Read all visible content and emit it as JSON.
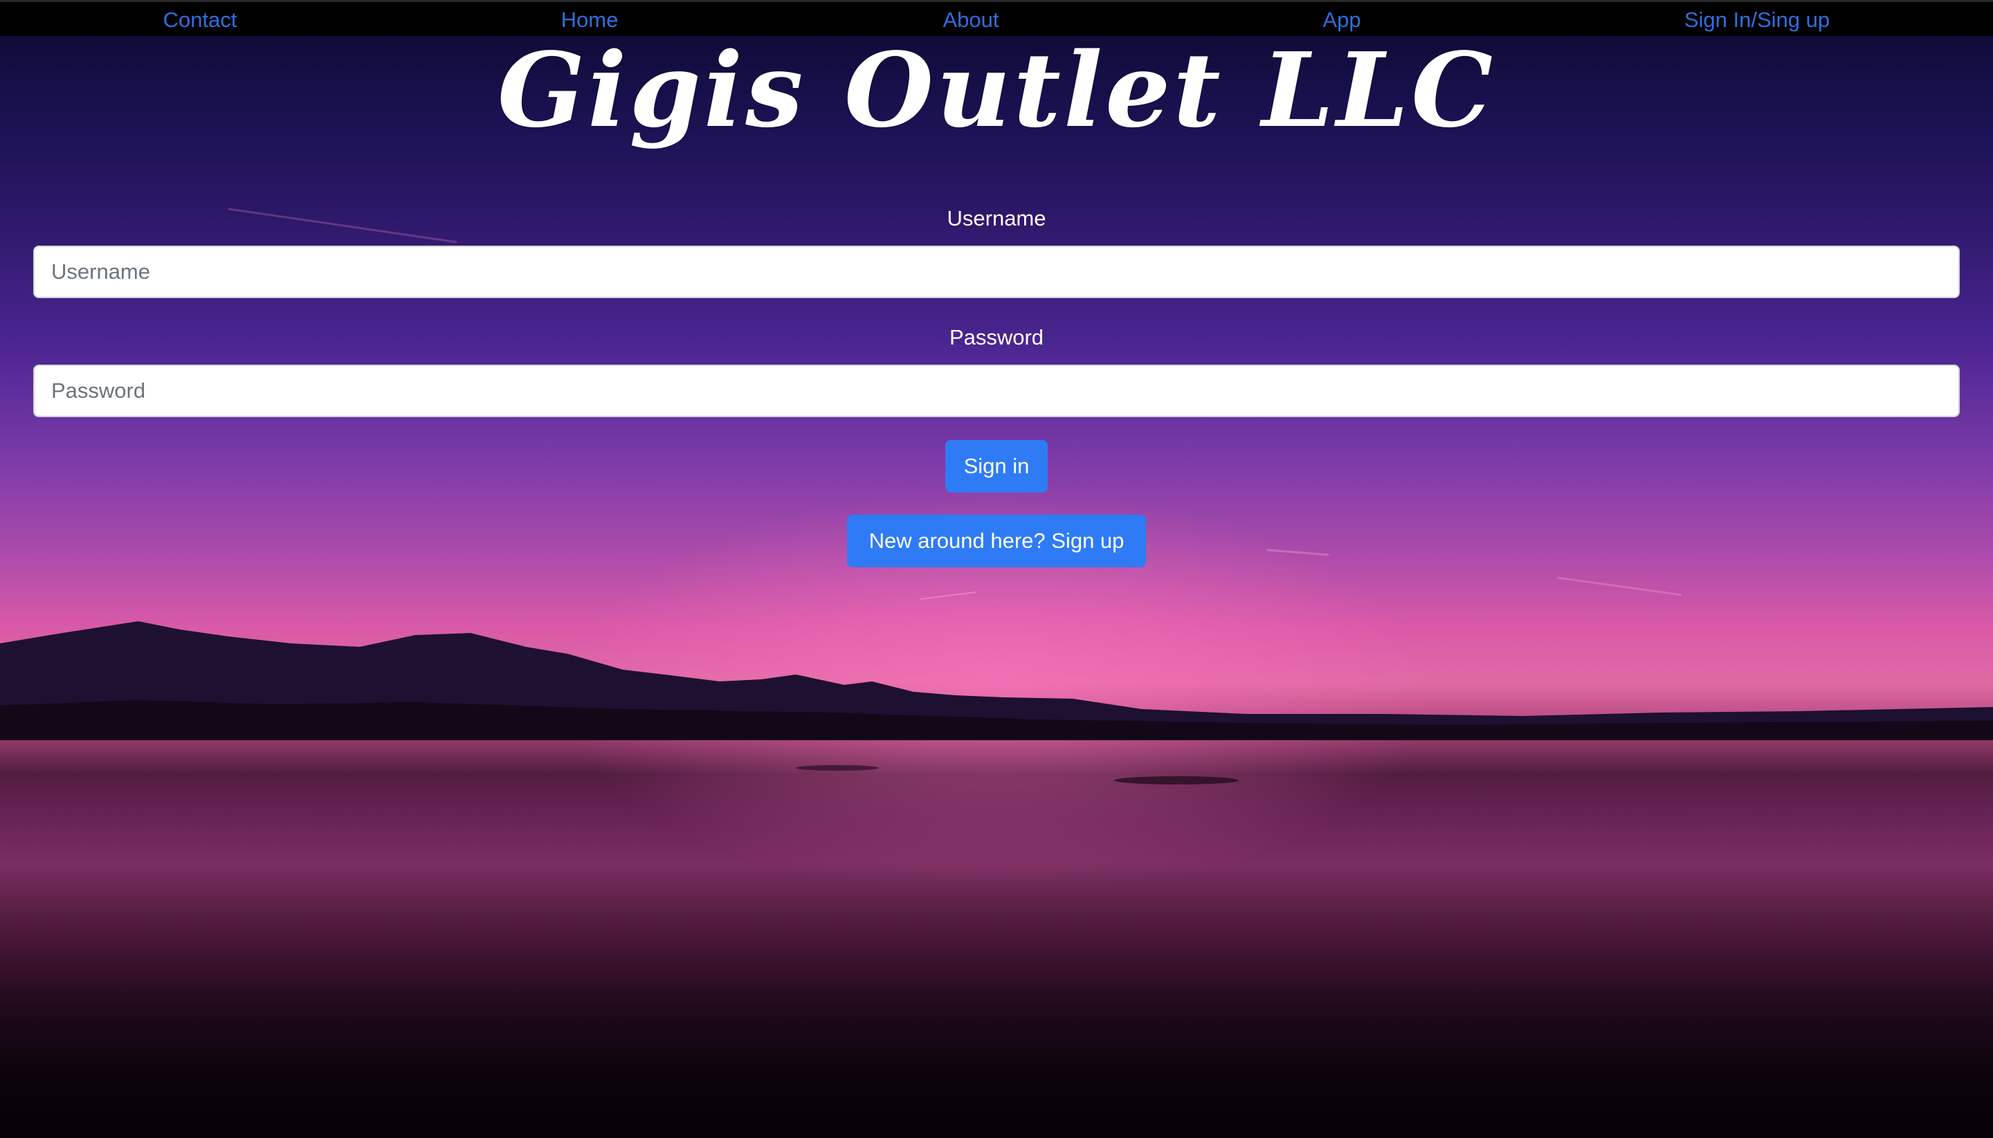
{
  "nav": {
    "items": [
      {
        "label": "Contact"
      },
      {
        "label": "Home"
      },
      {
        "label": "About"
      },
      {
        "label": "App"
      },
      {
        "label": "Sign In/Sing up"
      }
    ],
    "link_color": "#2f6fe0"
  },
  "header": {
    "title": "Gigis Outlet LLC"
  },
  "form": {
    "username_label": "Username",
    "username_placeholder": "Username",
    "username_value": "",
    "password_label": "Password",
    "password_placeholder": "Password",
    "password_value": "",
    "signin_label": "Sign in",
    "signup_label": "New around here? Sign up",
    "button_color": "#2f7bf5"
  },
  "background": {
    "description_colors": [
      "#16104a",
      "#7a3aa8",
      "#e06aa4",
      "#1c0a1c"
    ]
  }
}
